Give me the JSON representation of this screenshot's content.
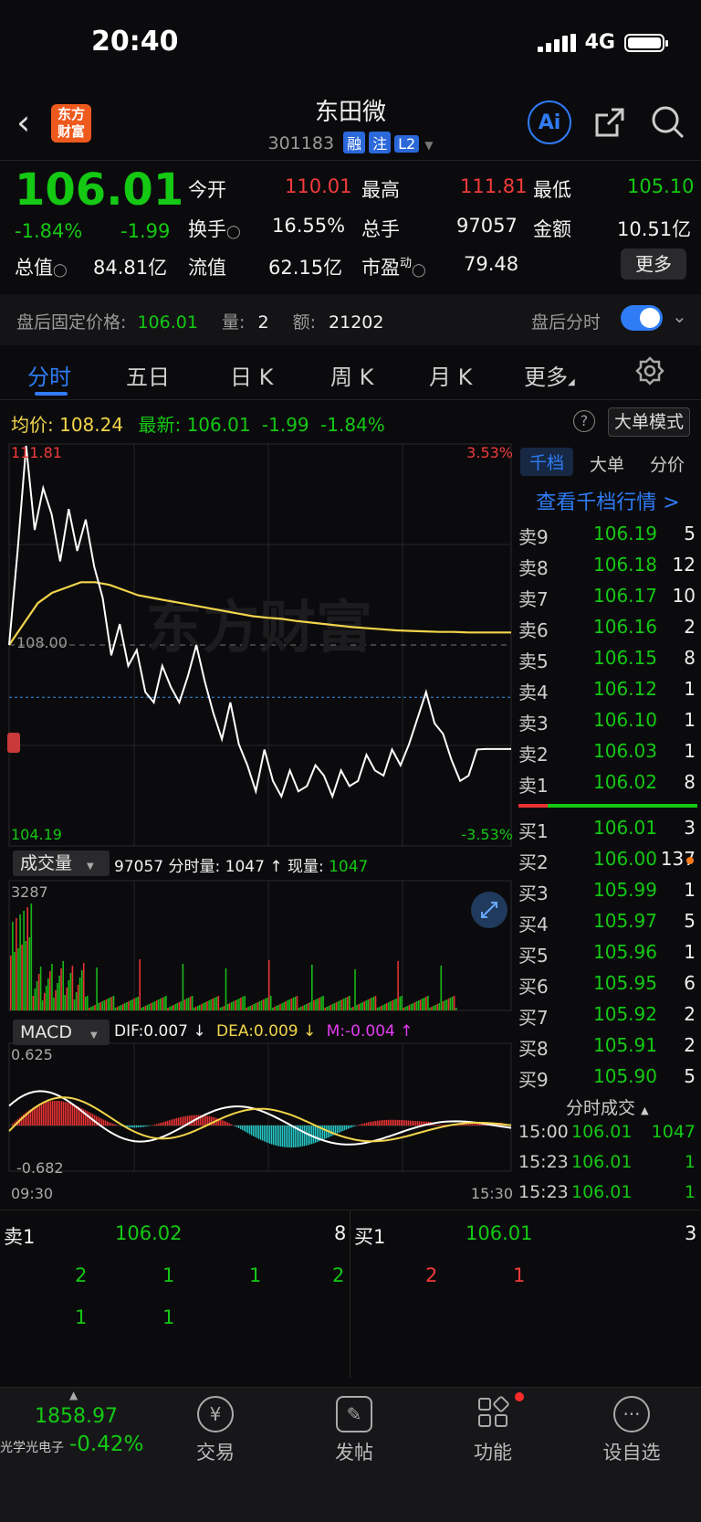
{
  "status": {
    "time": "20:40",
    "network": "4G"
  },
  "header": {
    "title": "东田微",
    "code": "301183",
    "tags": [
      "融",
      "注",
      "L2"
    ],
    "logo": [
      "东方",
      "财富"
    ],
    "ai_label": "Ai"
  },
  "quote": {
    "price": "106.01",
    "change_pct": "-1.84%",
    "change": "-1.99",
    "open_label": "今开",
    "open": "110.01",
    "high_label": "最高",
    "high": "111.81",
    "low_label": "最低",
    "low": "105.10",
    "turnover_label": "换手",
    "turnover": "16.55%",
    "volume_label": "总手",
    "volume": "97057",
    "amount_label": "金额",
    "amount": "10.51亿",
    "mcap_label": "总值",
    "mcap": "84.81亿",
    "float_label": "流值",
    "float": "62.15亿",
    "pe_label": "市盈",
    "pe_sup": "动",
    "pe": "79.48",
    "more": "更多"
  },
  "after_hours": {
    "price_label": "盘后固定价格:",
    "price": "106.01",
    "qty_label": "量:",
    "qty": "2",
    "amt_label": "额:",
    "amt": "21202",
    "toggle_label": "盘后分时"
  },
  "tabs": [
    "分时",
    "五日",
    "日 K",
    "周 K",
    "月 K",
    "更多"
  ],
  "chart_info": {
    "avg_label": "均价:",
    "avg": "108.24",
    "last_label": "最新:",
    "last": "106.01",
    "chg": "-1.99",
    "pct": "-1.84%",
    "big_order": "大单模式"
  },
  "chart_data": {
    "type": "line",
    "y_top": "111.81",
    "y_bottom": "104.19",
    "y_mid": "108.00",
    "pct_top": "3.53%",
    "pct_bottom": "-3.53%",
    "time_start": "09:30",
    "time_end": "15:30",
    "watermark": "东方财富",
    "price_series": [
      108.0,
      109.8,
      111.81,
      110.2,
      111.0,
      110.5,
      109.6,
      110.6,
      109.8,
      110.4,
      109.5,
      108.9,
      107.8,
      108.4,
      107.6,
      107.9,
      107.1,
      106.9,
      107.6,
      107.2,
      106.9,
      107.4,
      108.0,
      107.3,
      106.7,
      106.2,
      106.9,
      106.1,
      105.7,
      105.2,
      106.0,
      105.4,
      105.1,
      105.6,
      105.2,
      105.3,
      105.7,
      105.5,
      105.1,
      105.6,
      105.3,
      105.4,
      105.9,
      105.6,
      105.5,
      106.0,
      105.7,
      106.1,
      106.6,
      107.1,
      106.5,
      106.3,
      105.8,
      105.4,
      105.5,
      106.0,
      106.01,
      106.01,
      106.01,
      106.01
    ],
    "avg_series": [
      108.0,
      108.4,
      108.8,
      109.0,
      109.1,
      109.2,
      109.2,
      109.15,
      109.05,
      108.95,
      108.9,
      108.85,
      108.8,
      108.75,
      108.7,
      108.65,
      108.6,
      108.55,
      108.52,
      108.5,
      108.46,
      108.43,
      108.4,
      108.37,
      108.34,
      108.32,
      108.3,
      108.28,
      108.27,
      108.26,
      108.25,
      108.25,
      108.24,
      108.24,
      108.24,
      108.24
    ],
    "volume": {
      "label": "成交量",
      "total": "97057",
      "fs_label": "分时量:",
      "fs": "1047",
      "arrow": "↑",
      "now_label": "现量:",
      "now": "1047",
      "max": "3287"
    },
    "macd": {
      "label": "MACD",
      "dif": "DIF:0.007",
      "dif_arrow": "↓",
      "dea": "DEA:0.009",
      "dea_arrow": "↓",
      "m": "M:-0.004",
      "m_arrow": "↑",
      "top": "0.625",
      "bottom": "-0.682"
    }
  },
  "order_book": {
    "tabs": [
      "千档",
      "大单",
      "分价"
    ],
    "link": "查看千档行情 >",
    "asks": [
      {
        "l": "卖9",
        "p": "106.19",
        "v": "5"
      },
      {
        "l": "卖8",
        "p": "106.18",
        "v": "12"
      },
      {
        "l": "卖7",
        "p": "106.17",
        "v": "10"
      },
      {
        "l": "卖6",
        "p": "106.16",
        "v": "2"
      },
      {
        "l": "卖5",
        "p": "106.15",
        "v": "8"
      },
      {
        "l": "卖4",
        "p": "106.12",
        "v": "1"
      },
      {
        "l": "卖3",
        "p": "106.10",
        "v": "1"
      },
      {
        "l": "卖2",
        "p": "106.03",
        "v": "1"
      },
      {
        "l": "卖1",
        "p": "106.02",
        "v": "8"
      }
    ],
    "bids": [
      {
        "l": "买1",
        "p": "106.01",
        "v": "3"
      },
      {
        "l": "买2",
        "p": "106.00",
        "v": "137"
      },
      {
        "l": "买3",
        "p": "105.99",
        "v": "1"
      },
      {
        "l": "买4",
        "p": "105.97",
        "v": "5"
      },
      {
        "l": "买5",
        "p": "105.96",
        "v": "1"
      },
      {
        "l": "买6",
        "p": "105.95",
        "v": "6"
      },
      {
        "l": "买7",
        "p": "105.92",
        "v": "2"
      },
      {
        "l": "买8",
        "p": "105.91",
        "v": "2"
      },
      {
        "l": "买9",
        "p": "105.90",
        "v": "5"
      }
    ],
    "trades_label": "分时成交",
    "trades": [
      {
        "t": "15:00",
        "p": "106.01",
        "v": "1047"
      },
      {
        "t": "15:23",
        "p": "106.01",
        "v": "1"
      },
      {
        "t": "15:23",
        "p": "106.01",
        "v": "1"
      }
    ]
  },
  "level1": {
    "sell_label": "卖1",
    "sell_price": "106.02",
    "sell_qty": "8",
    "buy_label": "买1",
    "buy_price": "106.01",
    "buy_qty": "3",
    "sell_row1": [
      "2",
      "1",
      "1",
      "2"
    ],
    "sell_row2": [
      "1",
      "1"
    ],
    "buy_row1": [
      "2",
      "1"
    ]
  },
  "bottom_nav": {
    "index_value": "1858.97",
    "index_name": "光学光电子",
    "index_pct": "-0.42%",
    "items": [
      "交易",
      "发帖",
      "功能",
      "设自选"
    ]
  }
}
